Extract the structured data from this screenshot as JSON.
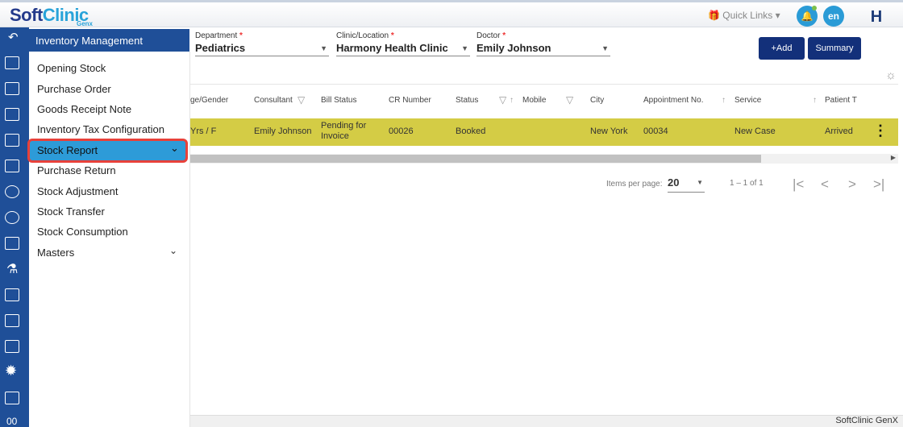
{
  "app": {
    "logo_main": "Soft",
    "logo_accent": "Clinic",
    "logo_sub": "Genx",
    "quick_links": "Quick Links",
    "lang": "en",
    "user_initial": "H",
    "footer": "SoftClinic GenX"
  },
  "menu": {
    "title": "Inventory Management",
    "items": [
      {
        "label": "Opening Stock"
      },
      {
        "label": "Purchase Order"
      },
      {
        "label": "Goods Receipt Note"
      },
      {
        "label": "Inventory Tax Configuration"
      },
      {
        "label": "Stock Report",
        "selected": true,
        "has_children": true
      },
      {
        "label": "Purchase Return"
      },
      {
        "label": "Stock Adjustment"
      },
      {
        "label": "Stock Transfer"
      },
      {
        "label": "Stock Consumption"
      },
      {
        "label": "Masters",
        "has_children": true
      }
    ]
  },
  "filters": {
    "department_label": "Department",
    "department": "Pediatrics",
    "clinic_label": "Clinic/Location",
    "clinic": "Harmony Health Clinic",
    "doctor_label": "Doctor",
    "doctor": "Emily Johnson",
    "required_mark": "*"
  },
  "buttons": {
    "add": "+Add",
    "summary": "Summary"
  },
  "table": {
    "columns": [
      "ge/Gender",
      "Consultant",
      "Bill Status",
      "CR Number",
      "Status",
      "Mobile",
      "City",
      "Appointment No.",
      "Service",
      "Patient T"
    ],
    "rows": [
      {
        "age_gender": "Yrs / F",
        "consultant": "Emily Johnson",
        "bill_status": "Pending for Invoice",
        "cr_number": "00026",
        "status": "Booked",
        "mobile": "",
        "city": "New York",
        "appointment_no": "00034",
        "service": "New Case",
        "patient_status": "Arrived"
      }
    ],
    "row_color": "#d4cc45"
  },
  "pagination": {
    "items_per_page_label": "Items per page:",
    "items_per_page": "20",
    "range": "1 – 1 of 1"
  },
  "colors": {
    "brand": "#1f4f98",
    "accent": "#2d9bd8",
    "highlight_outline": "#e8413a"
  }
}
